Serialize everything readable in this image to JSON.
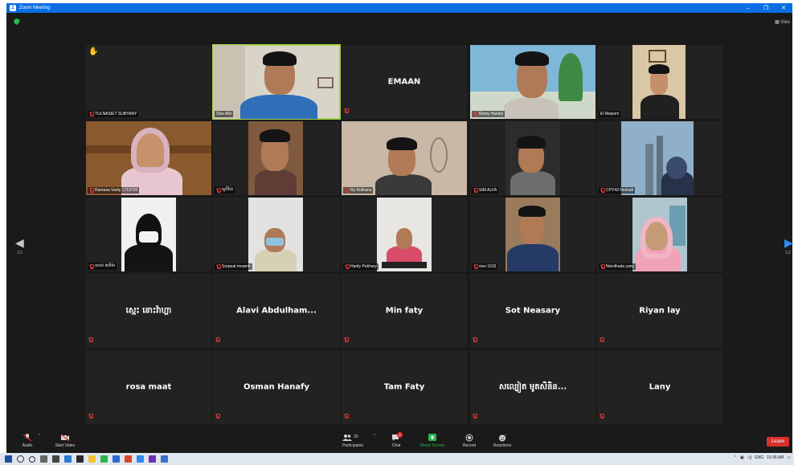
{
  "window": {
    "title": "Zoom Meeting",
    "controls": [
      "–",
      "❐",
      "✕"
    ]
  },
  "view_button": "Viev",
  "pager": {
    "left": "1/2",
    "right": "1/2"
  },
  "video_tiles": [
    {
      "name": "TULNASIET SUBYANY",
      "raised_hand": true
    },
    {
      "name": "Sles Afin",
      "speaking": true
    },
    {
      "name": "EMAAN",
      "display": "EMAAN"
    },
    {
      "name": "Romy Hanafy"
    },
    {
      "name": "El Maiyom"
    },
    {
      "name": "Ramasa Varity 1713720"
    },
    {
      "name": "ស្រេីវ៉ាន់"
    },
    {
      "name": "Ry Rothana"
    },
    {
      "name": "SIM ALFA"
    },
    {
      "name": "CPY43 Norisah"
    },
    {
      "name": "យាស់ ផាតីម៉ា"
    },
    {
      "name": "Sorpeat mnamh"
    },
    {
      "name": "Hanfy Pokhary"
    },
    {
      "name": "vivo 1915"
    },
    {
      "name": "Norolhuda yany"
    }
  ],
  "name_tiles": [
    "ស្មេះ នោះវ៉ាហ្គា",
    "Alavi  Abdulham...",
    "Min faty",
    "Sot Neasary",
    "Riyan lay",
    "rosa maat",
    "Osman Hanafy",
    "Tam Faty",
    "សល្បៀត មូតសិនិន...",
    "Lany"
  ],
  "toolbar": {
    "audio": "Audio",
    "start_video": "Start Video",
    "participants": "Participants",
    "participants_count": "29",
    "chat": "Chat",
    "chat_badge": "2",
    "share_screen": "Share Screen",
    "record": "Record",
    "reactions": "Reactions",
    "leave": "Leave"
  },
  "taskbar": {
    "lang": "ENG",
    "time": "10:36 AM"
  },
  "colors": {
    "accent": "#0b6ee2",
    "highlight": "#a5d64a",
    "share": "#28b94a",
    "leave": "#d9302e"
  }
}
